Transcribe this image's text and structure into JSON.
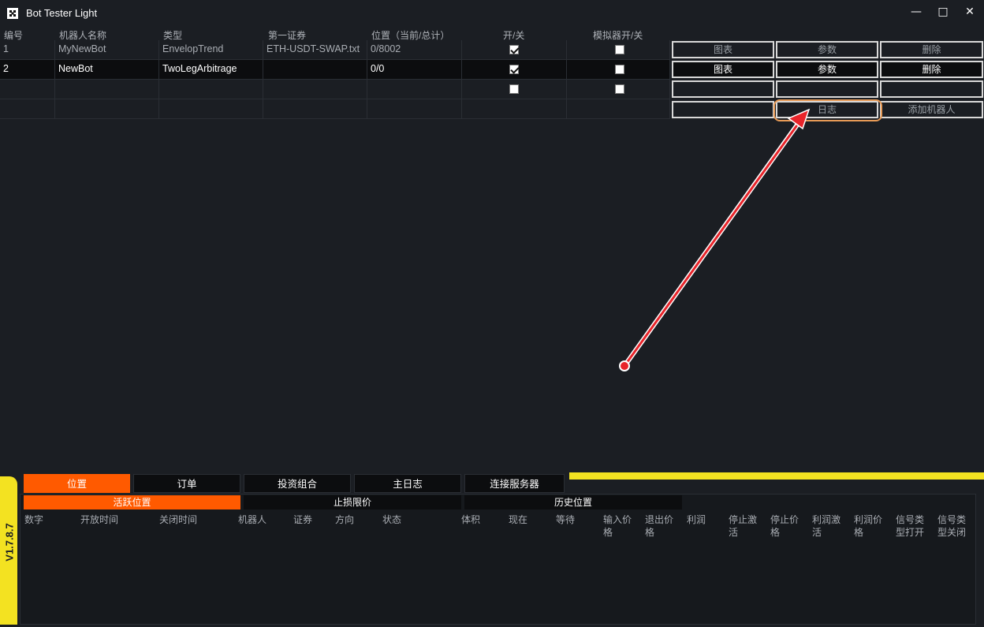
{
  "window": {
    "title": "Bot Tester Light",
    "minimize": "—",
    "maximize": "□",
    "close": "✕"
  },
  "grid": {
    "headers": [
      "编号",
      "机器人名称",
      "类型",
      "第一证券",
      "位置（当前/总计）",
      "开/关",
      "模拟器开/关"
    ],
    "rows": [
      {
        "num": "1",
        "name": "MyNewBot",
        "type": "EnvelopTrend",
        "security": "ETH-USDT-SWAP.txt",
        "position": "0/8002",
        "on": true,
        "emulator": false
      },
      {
        "num": "2",
        "name": "NewBot",
        "type": "TwoLegArbitrage",
        "security": "",
        "position": "0/0",
        "on": true,
        "emulator": false
      },
      {
        "num": "",
        "name": "",
        "type": "",
        "security": "",
        "position": "",
        "on": false,
        "emulator": false
      }
    ]
  },
  "row_buttons": {
    "chart": "图表",
    "params": "参数",
    "delete": "删除"
  },
  "footer_buttons": {
    "log": "日志",
    "add_bot": "添加机器人"
  },
  "bottom": {
    "version": "V1.7.8.7",
    "tabs": [
      "位置",
      "订单",
      "投资组合",
      "主日志",
      "连接服务器"
    ],
    "subtabs": [
      "活跃位置",
      "止损限价",
      "历史位置"
    ],
    "columns": [
      "数字",
      "开放时间",
      "关闭时间",
      "机器人",
      "证券",
      "方向",
      "状态",
      "体积",
      "现在",
      "等待",
      "输入价格",
      "退出价格",
      "利润",
      "停止激活",
      "停止价格",
      "利润激活",
      "利润价格",
      "信号类型打开",
      "信号类型关闭"
    ]
  },
  "colors": {
    "accent": "#ff5a00",
    "yellow": "#f3e221",
    "annotation": "#e8242a"
  }
}
